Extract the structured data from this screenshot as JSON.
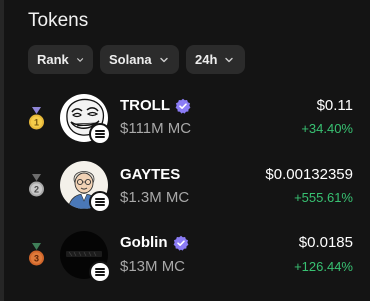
{
  "section": {
    "title": "Tokens"
  },
  "filters": {
    "rank_label": "Rank",
    "chain_label": "Solana",
    "timeframe_label": "24h"
  },
  "colors": {
    "background": "#141414",
    "chip": "#2b2b2b",
    "positive": "#38c172",
    "muted": "#a8a8a8",
    "verified": "#8b7cf6"
  },
  "tokens": [
    {
      "rank": "1",
      "name": "TROLL",
      "market_cap": "$111M MC",
      "price": "$0.11",
      "change": "+34.40%",
      "verified": true,
      "avatar_icon": "trollface-icon"
    },
    {
      "rank": "2",
      "name": "GAYTES",
      "market_cap": "$1.3M MC",
      "price": "$0.00132359",
      "change": "+555.61%",
      "verified": false,
      "avatar_icon": "cartoon-man-icon"
    },
    {
      "rank": "3",
      "name": "Goblin",
      "market_cap": "$13M MC",
      "price": "$0.0185",
      "change": "+126.44%",
      "verified": true,
      "avatar_icon": "dark-goblin-logo-icon"
    }
  ]
}
